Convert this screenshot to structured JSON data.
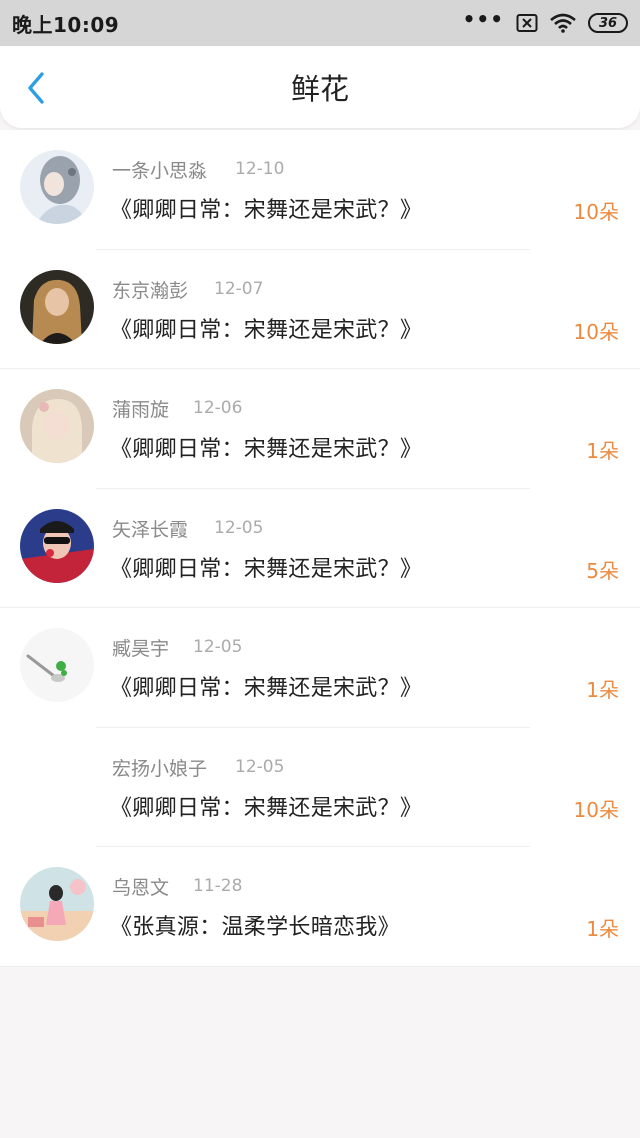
{
  "status_bar": {
    "time": "晚上10:09",
    "dots": "•••",
    "battery": "36"
  },
  "header": {
    "title": "鲜花",
    "accent_color": "#2f9ee6"
  },
  "flowers": [
    {
      "name": "一条小思淼",
      "date": "12-10",
      "title": "《卿卿日常：宋舞还是宋武？》",
      "count": "10朵"
    },
    {
      "name": "东京瀚彭",
      "date": "12-07",
      "title": "《卿卿日常：宋舞还是宋武？》",
      "count": "10朵"
    },
    {
      "name": "蒲雨旋",
      "date": "12-06",
      "title": "《卿卿日常：宋舞还是宋武？》",
      "count": "1朵"
    },
    {
      "name": "矢泽长霞",
      "date": "12-05",
      "title": "《卿卿日常：宋舞还是宋武？》",
      "count": "5朵"
    },
    {
      "name": "臧昊宇",
      "date": "12-05",
      "title": "《卿卿日常：宋舞还是宋武？》",
      "count": "1朵"
    },
    {
      "name": "宏扬小娘子",
      "date": "12-05",
      "title": "《卿卿日常：宋舞还是宋武？》",
      "count": "10朵"
    },
    {
      "name": "乌恩文",
      "date": "11-28",
      "title": "《张真源：温柔学长暗恋我》",
      "count": "1朵"
    }
  ],
  "count_color": "#ee8a40"
}
